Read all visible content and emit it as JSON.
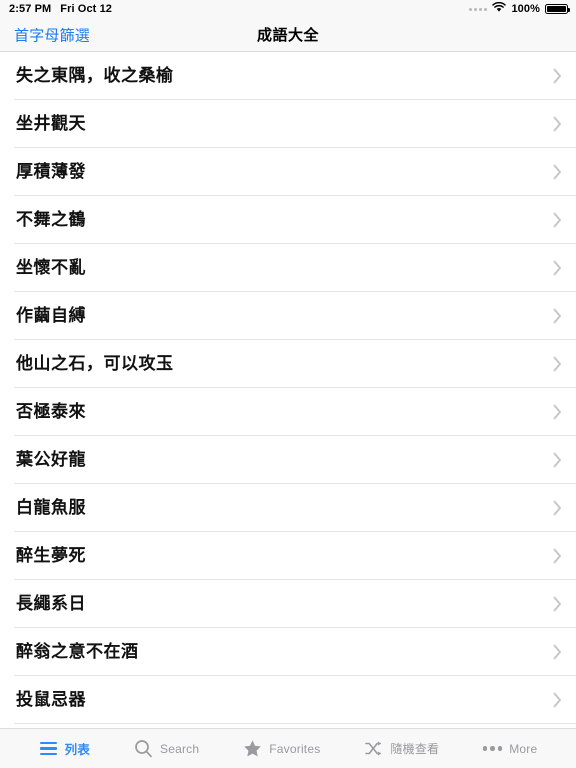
{
  "statusbar": {
    "time": "2:57 PM",
    "date": "Fri Oct 12",
    "battery_percent": "100%",
    "signal_icon": "signal-dots-icon",
    "wifi_icon": "wifi-icon",
    "battery_icon": "battery-full-icon"
  },
  "navbar": {
    "left_button": "首字母篩選",
    "title": "成語大全"
  },
  "list": {
    "items": [
      {
        "label": "失之東隅，收之桑榆"
      },
      {
        "label": "坐井觀天"
      },
      {
        "label": "厚積薄發"
      },
      {
        "label": "不舞之鶴"
      },
      {
        "label": "坐懷不亂"
      },
      {
        "label": "作繭自縛"
      },
      {
        "label": "他山之石，可以攻玉"
      },
      {
        "label": "否極泰來"
      },
      {
        "label": "葉公好龍"
      },
      {
        "label": "白龍魚服"
      },
      {
        "label": "醉生夢死"
      },
      {
        "label": "長繩系日"
      },
      {
        "label": "醉翁之意不在酒"
      },
      {
        "label": "投鼠忌器"
      }
    ],
    "disclosure_icon": "chevron-right-icon"
  },
  "tabbar": {
    "tabs": [
      {
        "label": "列表",
        "icon": "list-hamburger-icon",
        "active": true
      },
      {
        "label": "Search",
        "icon": "search-icon",
        "active": false
      },
      {
        "label": "Favorites",
        "icon": "star-icon",
        "active": false
      },
      {
        "label": "隨機查看",
        "icon": "shuffle-icon",
        "active": false
      },
      {
        "label": "More",
        "icon": "ellipsis-icon",
        "active": false
      }
    ]
  },
  "colors": {
    "accent": "#2d8cf5",
    "nav_link": "#1a7ced",
    "chrome_bg": "#f8f8f8",
    "separator": "#e4e4e6",
    "inactive_tab": "#9a9a9f",
    "chevron": "#c7c7cc"
  }
}
